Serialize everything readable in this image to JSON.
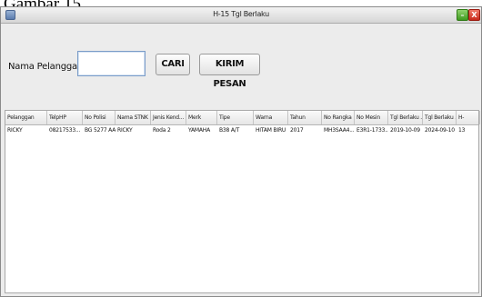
{
  "caption": "Gambar 15.",
  "window": {
    "title": "H-15 Tgl Berlaku",
    "minimize_icon": "minimize-icon",
    "close_icon": "close-icon",
    "minimize_glyph": "–",
    "close_glyph": "X"
  },
  "form": {
    "name_label": "Nama Pelanggan :",
    "name_value": "",
    "search_button": "CARI",
    "send_button": "KIRIM PESAN"
  },
  "table": {
    "columns": [
      "Pelanggan",
      "TelpHP",
      "No Polisi",
      "Nama STNK",
      "Jenis Kend...",
      "Merk",
      "Tipe",
      "Warna",
      "Tahun",
      "No Rangka",
      "No Mesin",
      "Tgl Berlaku ...",
      "Tgl Berlaku ...",
      "H-"
    ],
    "rows": [
      [
        "RICKY",
        "08217533...",
        "BG 5277 AA",
        "RICKY",
        "Roda 2",
        "YAMAHA",
        "B38 A/T",
        "HITAM BIRU",
        "2017",
        "MH3SAA4...",
        "E3R1-1733...",
        "2019-10-09",
        "2024-09-10",
        "13"
      ]
    ]
  }
}
